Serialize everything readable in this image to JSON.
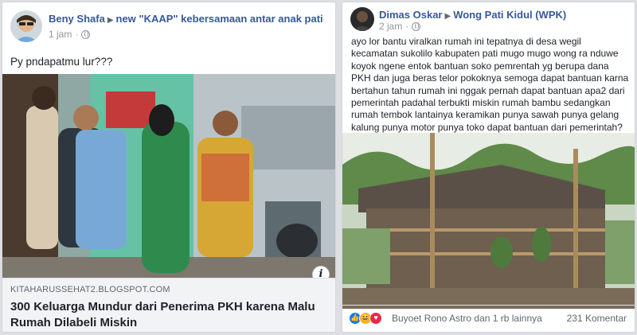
{
  "left_post": {
    "author": "Beny Shafa",
    "group": "new \"KAAP\" kebersamaan antar anak pati",
    "time": "1 jam",
    "text": "Py pndapatmu lur???",
    "link": {
      "domain": "KITAHARUSSEHAT2.BLOGSPOT.COM",
      "title": "300 Keluarga Mundur dari Penerima PKH karena Malu Rumah Dilabeli Miskin"
    },
    "icons": {
      "privacy": "globe-icon",
      "info": "info-icon"
    }
  },
  "right_post": {
    "author": "Dimas Oskar",
    "group": "Wong Pati Kidul (WPK)",
    "time": "2 jam",
    "text": "ayo lor bantu viralkan rumah ini tepatnya di desa wegil kecamatan sukolilo kabupaten pati mugo mugo wong ra nduwe koyok ngene entok bantuan soko pemrentah yg berupa dana PKH dan juga beras telor pokoknya semoga dapat bantuan karna bertahun tahun rumah ini nggak pernah dapat bantuan apa2 dari pemerintah padahal terbukti miskin rumah bambu sedangkan rumah tembok lantainya keramikan punya sawah punya gelang kalung punya motor punya toko dapat bantuan dari pemerintah?tolong bantu share ya.",
    "reactions_text": "Buyoet Rono Astro dan 1 rb lainnya",
    "comments": "231 Komentar",
    "icons": {
      "privacy": "globe-icon",
      "reactions": [
        "like-icon",
        "haha-icon",
        "love-icon"
      ]
    }
  }
}
